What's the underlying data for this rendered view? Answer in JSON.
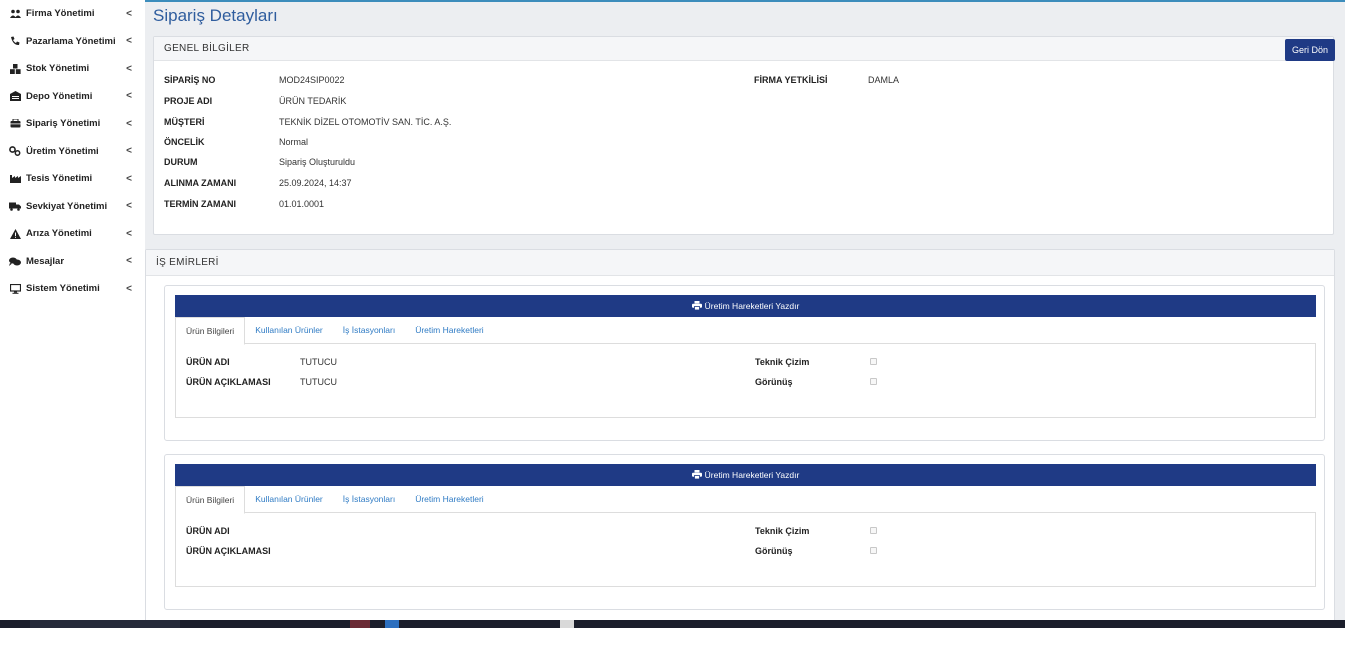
{
  "sidebar": {
    "items": [
      {
        "label": "Firma Yönetimi",
        "icon": "users-icon"
      },
      {
        "label": "Pazarlama Yönetimi",
        "icon": "phone-icon"
      },
      {
        "label": "Stok Yönetimi",
        "icon": "boxes-icon"
      },
      {
        "label": "Depo Yönetimi",
        "icon": "warehouse-icon"
      },
      {
        "label": "Sipariş Yönetimi",
        "icon": "cart-icon"
      },
      {
        "label": "Üretim Yönetimi",
        "icon": "cogs-icon"
      },
      {
        "label": "Tesis Yönetimi",
        "icon": "industry-icon"
      },
      {
        "label": "Sevkiyat Yönetimi",
        "icon": "truck-icon"
      },
      {
        "label": "Arıza Yönetimi",
        "icon": "warning-icon"
      },
      {
        "label": "Mesajlar",
        "icon": "messages-icon"
      },
      {
        "label": "Sistem Yönetimi",
        "icon": "desktop-icon"
      }
    ],
    "chevron": "<"
  },
  "page": {
    "title": "Sipariş Detayları",
    "back_button": "Geri Dön"
  },
  "general": {
    "header": "GENEL BİLGİLER",
    "fields": [
      {
        "label": "SİPARİŞ NO",
        "value": "MOD24SIP0022"
      },
      {
        "label": "PROJE ADI",
        "value": "ÜRÜN TEDARİK"
      },
      {
        "label": "MÜŞTERİ",
        "value": "TEKNİK DİZEL OTOMOTİV SAN. TİC. A.Ş."
      },
      {
        "label": "ÖNCELİK",
        "value": "Normal"
      },
      {
        "label": "DURUM",
        "value": "Sipariş Oluşturuldu"
      },
      {
        "label": "ALINMA ZAMANI",
        "value": "25.09.2024, 14:37"
      },
      {
        "label": "TERMİN ZAMANI",
        "value": "01.01.0001"
      }
    ],
    "right_field": {
      "label": "FİRMA YETKİLİSİ",
      "value": "DAMLA"
    }
  },
  "work_orders": {
    "header": "İŞ EMİRLERİ",
    "print_label": "Üretim Hareketleri Yazdır",
    "tabs": [
      "Ürün Bilgileri",
      "Kullanılan Ürünler",
      "İş İstasyonları",
      "Üretim Hareketleri"
    ],
    "labels": {
      "product_name": "ÜRÜN ADI",
      "product_desc": "ÜRÜN AÇIKLAMASI",
      "technical_drawing": "Teknik Çizim",
      "view": "Görünüş"
    },
    "orders": [
      {
        "product_name": "TUTUCU",
        "product_desc": "TUTUCU"
      },
      {
        "product_name": "",
        "product_desc": ""
      }
    ]
  }
}
